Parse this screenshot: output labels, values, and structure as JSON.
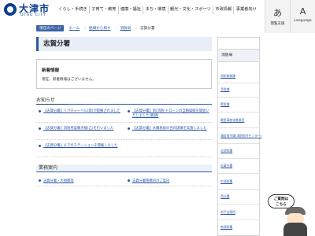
{
  "header": {
    "logo_text": "大津市",
    "logo_sub": "OTSU CITY",
    "nav": [
      "くらし・手続き",
      "子育て・教育",
      "健康・福祉",
      "まち・環境",
      "観光・文化・スポーツ",
      "市政情報",
      "事業者向け"
    ],
    "font_btn_glyph": "あ",
    "font_btn_label": "閲覧支援",
    "lang_btn_glyph": "A",
    "lang_btn_label": "Language"
  },
  "breadcrumb": {
    "home_btn": "現在のページ",
    "items": [
      "ホーム",
      "組織から探す",
      "消防局"
    ],
    "current": "志賀分署"
  },
  "page_title": "志賀分署",
  "news": {
    "heading": "新着情報",
    "body": "現在、新着情報はございません。"
  },
  "notices": {
    "heading": "お知らせ",
    "left": [
      "【志賀分署】リクチャーベル(新)が配備されました",
      "【志賀分署】消防用設備点検(乙)を行いました",
      "【志賀分署】までのステーションを開催しました"
    ],
    "right": [
      "【志賀分署】新(消防)ドローンの自動操縦を開始いたしました(要請)",
      "【志賀分署】水難救助の合同訓練を実施しました"
    ]
  },
  "business": {
    "heading": "業務案内",
    "items": [
      "志賀分署・大規模等",
      "志賀分署管轄内のご案内"
    ]
  },
  "sidebar": {
    "heading": "消防局",
    "items": [
      "消防総務課",
      "予防課",
      "警防課",
      "救急高度化推進室",
      "通信指令課(消防指令センター)",
      "北消防署",
      "志賀分署",
      "中消防署",
      "西分署",
      "木戸出張所",
      "南消防署"
    ]
  },
  "chat": {
    "line1": "ご質問は",
    "line2": "こちら"
  }
}
